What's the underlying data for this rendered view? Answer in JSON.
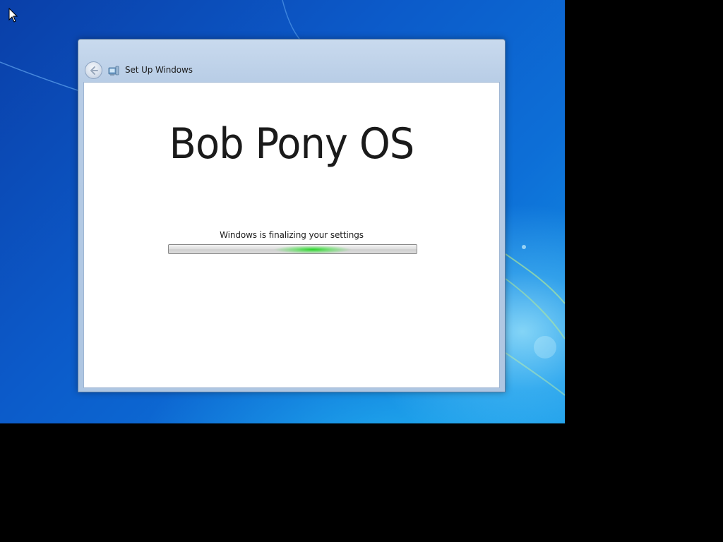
{
  "window": {
    "title": "Set Up Windows"
  },
  "main": {
    "brand_title": "Bob Pony OS",
    "status_text": "Windows is finalizing your settings"
  },
  "progress": {
    "mode": "indeterminate",
    "glow_center_percent": 58,
    "color": "#2fd02f"
  },
  "icons": {
    "cursor": "arrow-cursor-icon",
    "back": "back-arrow-icon",
    "app": "setup-computer-icon"
  },
  "colors": {
    "desktop": "#0d5ec9",
    "window_frame": "#b8cde6",
    "content_bg": "#ffffff"
  }
}
